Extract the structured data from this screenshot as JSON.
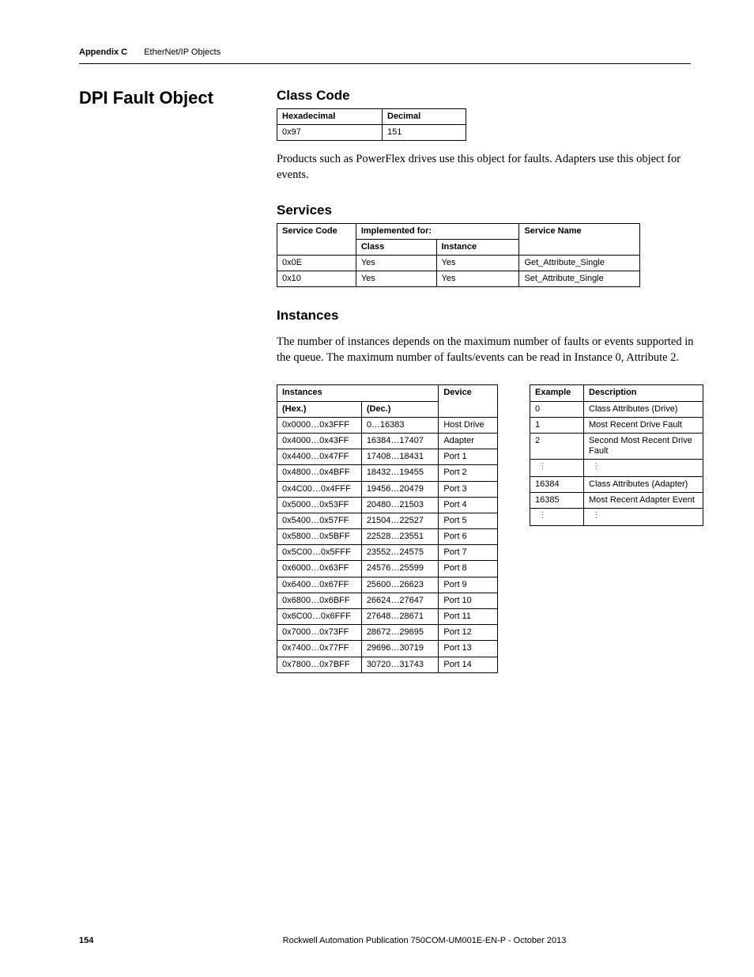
{
  "header": {
    "appendix": "Appendix C",
    "topic": "EtherNet/IP Objects"
  },
  "title": "DPI Fault Object",
  "classCode": {
    "heading": "Class Code",
    "cols": {
      "hex": "Hexadecimal",
      "dec": "Decimal"
    },
    "row": {
      "hex": "0x97",
      "dec": "151"
    }
  },
  "intro": "Products such as PowerFlex drives use this object for faults. Adapters use this object for events.",
  "services": {
    "heading": "Services",
    "cols": {
      "code": "Service Code",
      "impl": "Implemented for:",
      "class": "Class",
      "instance": "Instance",
      "name": "Service Name"
    },
    "rows": [
      {
        "code": "0x0E",
        "class": "Yes",
        "instance": "Yes",
        "name": "Get_Attribute_Single"
      },
      {
        "code": "0x10",
        "class": "Yes",
        "instance": "Yes",
        "name": "Set_Attribute_Single"
      }
    ]
  },
  "instances": {
    "heading": "Instances",
    "para": "The number of instances depends on the maximum number of faults or events supported in the queue. The maximum number of faults/events can be read in Instance 0, Attribute 2.",
    "leftTable": {
      "cols": {
        "inst": "Instances",
        "hex": "(Hex.)",
        "dec": "(Dec.)",
        "device": "Device"
      },
      "rows": [
        {
          "hex": "0x0000…0x3FFF",
          "dec": "0…16383",
          "device": "Host Drive"
        },
        {
          "hex": "0x4000…0x43FF",
          "dec": "16384…17407",
          "device": "Adapter"
        },
        {
          "hex": "0x4400…0x47FF",
          "dec": "17408…18431",
          "device": "Port 1"
        },
        {
          "hex": "0x4800…0x4BFF",
          "dec": "18432…19455",
          "device": "Port 2"
        },
        {
          "hex": "0x4C00…0x4FFF",
          "dec": "19456…20479",
          "device": "Port 3"
        },
        {
          "hex": "0x5000…0x53FF",
          "dec": "20480…21503",
          "device": "Port 4"
        },
        {
          "hex": "0x5400…0x57FF",
          "dec": "21504…22527",
          "device": "Port 5"
        },
        {
          "hex": "0x5800…0x5BFF",
          "dec": "22528…23551",
          "device": "Port 6"
        },
        {
          "hex": "0x5C00…0x5FFF",
          "dec": "23552…24575",
          "device": "Port 7"
        },
        {
          "hex": "0x6000…0x63FF",
          "dec": "24576…25599",
          "device": "Port 8"
        },
        {
          "hex": "0x6400…0x67FF",
          "dec": "25600…26623",
          "device": "Port 9"
        },
        {
          "hex": "0x6800…0x6BFF",
          "dec": "26624…27647",
          "device": "Port 10"
        },
        {
          "hex": "0x6C00…0x6FFF",
          "dec": "27648…28671",
          "device": "Port 11"
        },
        {
          "hex": "0x7000…0x73FF",
          "dec": "28672…29695",
          "device": "Port 12"
        },
        {
          "hex": "0x7400…0x77FF",
          "dec": "29696…30719",
          "device": "Port 13"
        },
        {
          "hex": "0x7800…0x7BFF",
          "dec": "30720…31743",
          "device": "Port 14"
        }
      ]
    },
    "rightTable": {
      "cols": {
        "example": "Example",
        "desc": "Description"
      },
      "rows": [
        {
          "example": "0",
          "desc": "Class Attributes (Drive)"
        },
        {
          "example": "1",
          "desc": "Most Recent Drive Fault"
        },
        {
          "example": "2",
          "desc": "Second Most Recent Drive Fault"
        },
        {
          "example": "__vdots__",
          "desc": "__vdots__"
        },
        {
          "example": "16384",
          "desc": "Class Attributes (Adapter)"
        },
        {
          "example": "16385",
          "desc": "Most Recent Adapter Event"
        },
        {
          "example": "__vdots__",
          "desc": "__vdots__"
        }
      ]
    }
  },
  "footer": {
    "page": "154",
    "pub": "Rockwell Automation Publication 750COM-UM001E-EN-P - October 2013"
  }
}
